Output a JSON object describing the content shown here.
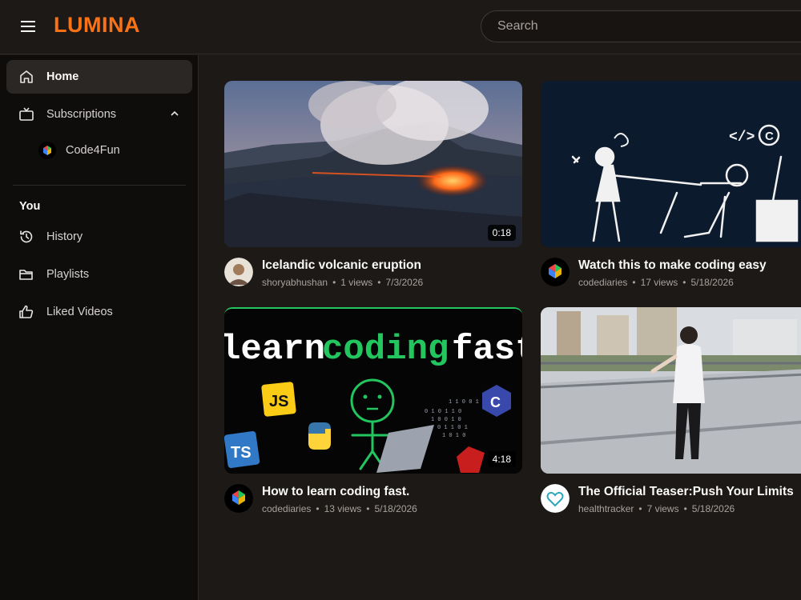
{
  "app": {
    "brand": "LUMINA",
    "accent": "#f97316"
  },
  "header": {
    "search_placeholder": "Search"
  },
  "sidebar": {
    "home": "Home",
    "subscriptions": "Subscriptions",
    "subscription_items": [
      {
        "name": "Code4Fun"
      }
    ],
    "section_you": "You",
    "history": "History",
    "playlists": "Playlists",
    "liked": "Liked Videos"
  },
  "videos": [
    {
      "title": "Icelandic volcanic eruption",
      "channel": "shoryabhushan",
      "views": "1 views",
      "date": "7/3/2026",
      "duration": "0:18"
    },
    {
      "title": "Watch this to make coding easy",
      "channel": "codediaries",
      "views": "17 views",
      "date": "5/18/2026",
      "duration": ""
    },
    {
      "title": "How to learn coding fast.",
      "channel": "codediaries",
      "views": "13 views",
      "date": "5/18/2026",
      "duration": "4:18",
      "thumb_text_1": "learn",
      "thumb_text_2": "coding",
      "thumb_text_3": "fast",
      "badges": [
        "JS",
        "TS",
        "C"
      ]
    },
    {
      "title": "The Official Teaser:Push Your Limits",
      "channel": "healthtracker",
      "views": "7 views",
      "date": "5/18/2026",
      "duration": ""
    }
  ],
  "icons": {
    "menu": "hamburger-icon",
    "home": "home-icon",
    "subscriptions": "tv-icon",
    "history": "history-icon",
    "playlists": "folder-icon",
    "liked": "thumbs-up-icon"
  }
}
